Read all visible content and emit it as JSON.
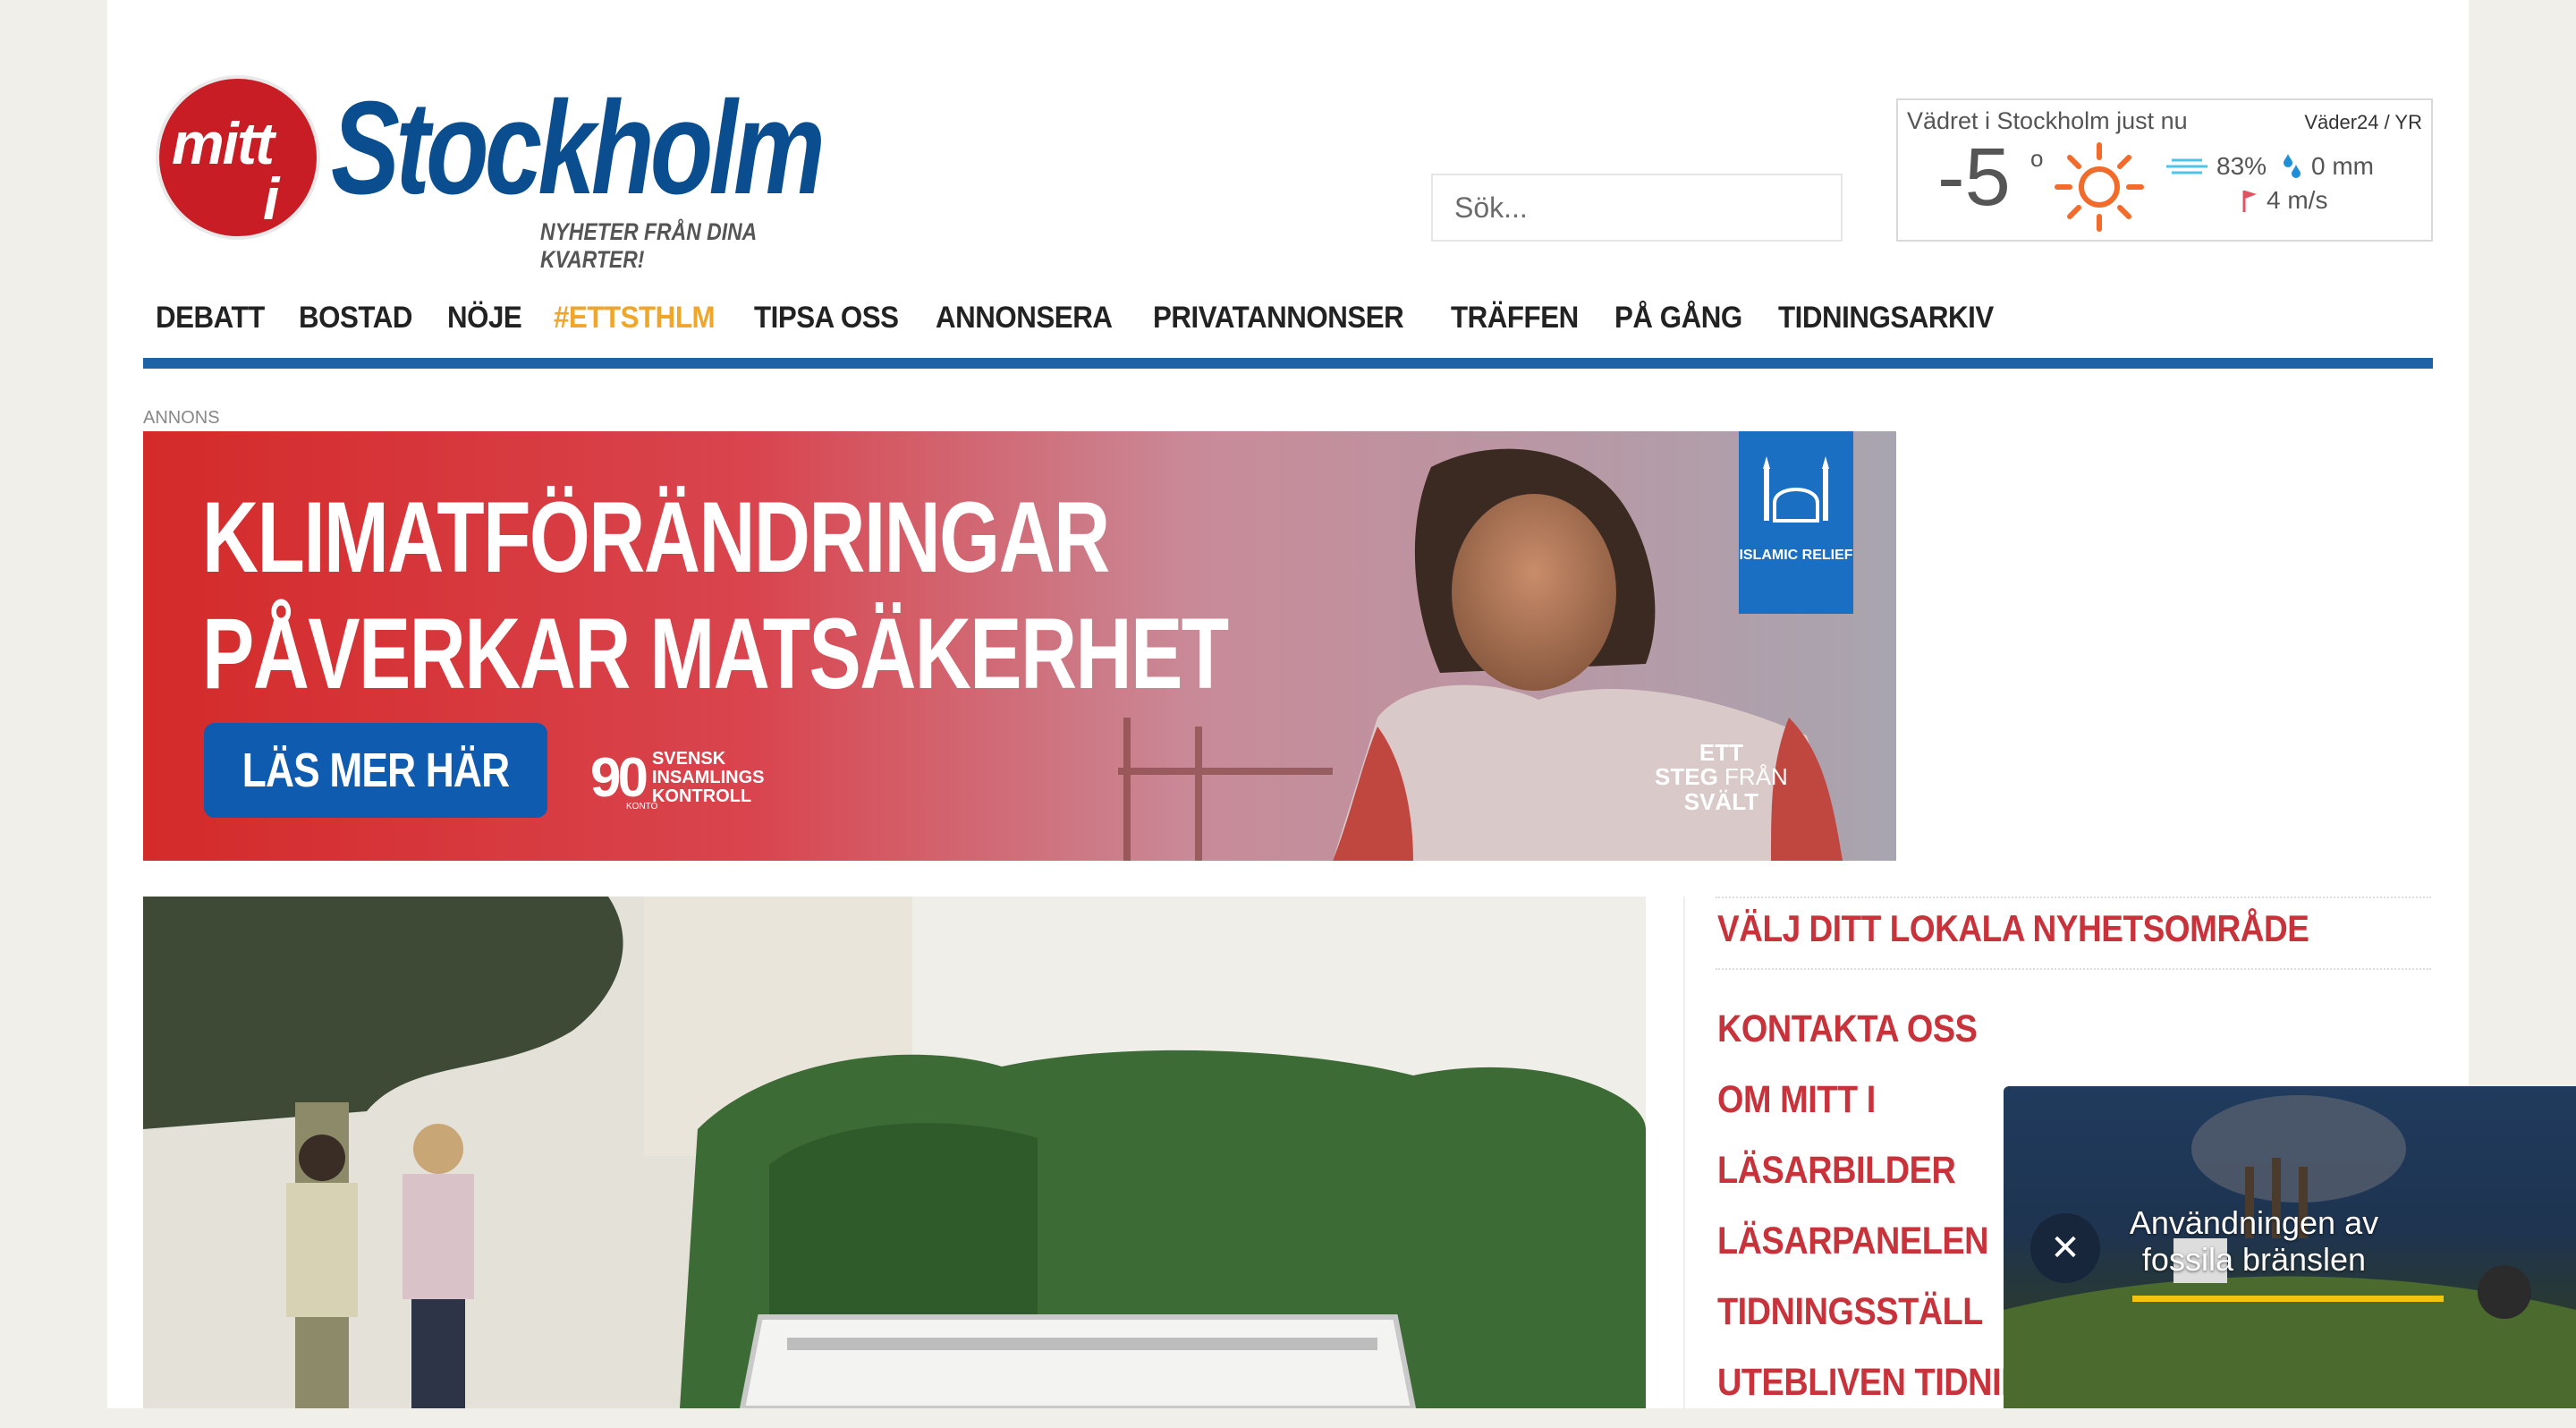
{
  "logo": {
    "mitt": "mitt",
    "i": "i",
    "wordmark": "Stockholm",
    "tagline": "NYHETER FRÅN DINA KVARTER!"
  },
  "search": {
    "placeholder": "Sök..."
  },
  "weather": {
    "title": "Vädret i Stockholm just nu",
    "source": "Väder24 / YR",
    "temperature": "-5",
    "degree": "o",
    "humidity": "83%",
    "precipitation": "0 mm",
    "wind": "4 m/s",
    "icons": {
      "condition": "sun-icon",
      "humidity": "haze-icon",
      "rain": "droplets-icon",
      "wind": "wind-flag-icon"
    }
  },
  "nav": {
    "items": [
      {
        "label": "DEBATT"
      },
      {
        "label": "BOSTAD"
      },
      {
        "label": "NÖJE"
      },
      {
        "label": "#ETTSTHLM",
        "highlight": true
      },
      {
        "label": "TIPSA OSS"
      },
      {
        "label": "ANNONSERA"
      },
      {
        "label": "PRIVATANNONSER"
      },
      {
        "label": "TRÄFFEN"
      },
      {
        "label": "PÅ GÅNG"
      },
      {
        "label": "TIDNINGSARKIV"
      }
    ],
    "accent": "#1d63a5",
    "highlight_color": "#f0a629"
  },
  "ad": {
    "label": "ANNONS",
    "headline_1": "KLIMATFÖRÄNDRINGAR",
    "headline_2": "PÅVERKAR MATSÄKERHET",
    "button": "LÄS MER HÄR",
    "badge_90": "90",
    "badge_konto": "KONTO",
    "svensk": "SVENSK",
    "insamlings": "INSAMLINGS",
    "kontroll": "KONTROLL",
    "org": "ISLAMIC RELIEF",
    "step_1": "ETT",
    "step_2": "STEG",
    "step_3": "FRÅN",
    "step_4": "SVÄLT"
  },
  "sidebar": {
    "heading": "VÄLJ DITT LOKALA NYHETSOMRÅDE",
    "links": [
      {
        "label": "KONTAKTA OSS"
      },
      {
        "label": "OM MITT I"
      },
      {
        "label": "LÄSARBILDER"
      },
      {
        "label": "LÄSARPANELEN"
      },
      {
        "label": "TIDNINGSSTÄLL"
      },
      {
        "label": "UTEBLIVEN TIDNING"
      }
    ],
    "color": "#c8323a"
  },
  "video": {
    "caption": "Användningen av fossila bränslen",
    "close": "✕"
  }
}
